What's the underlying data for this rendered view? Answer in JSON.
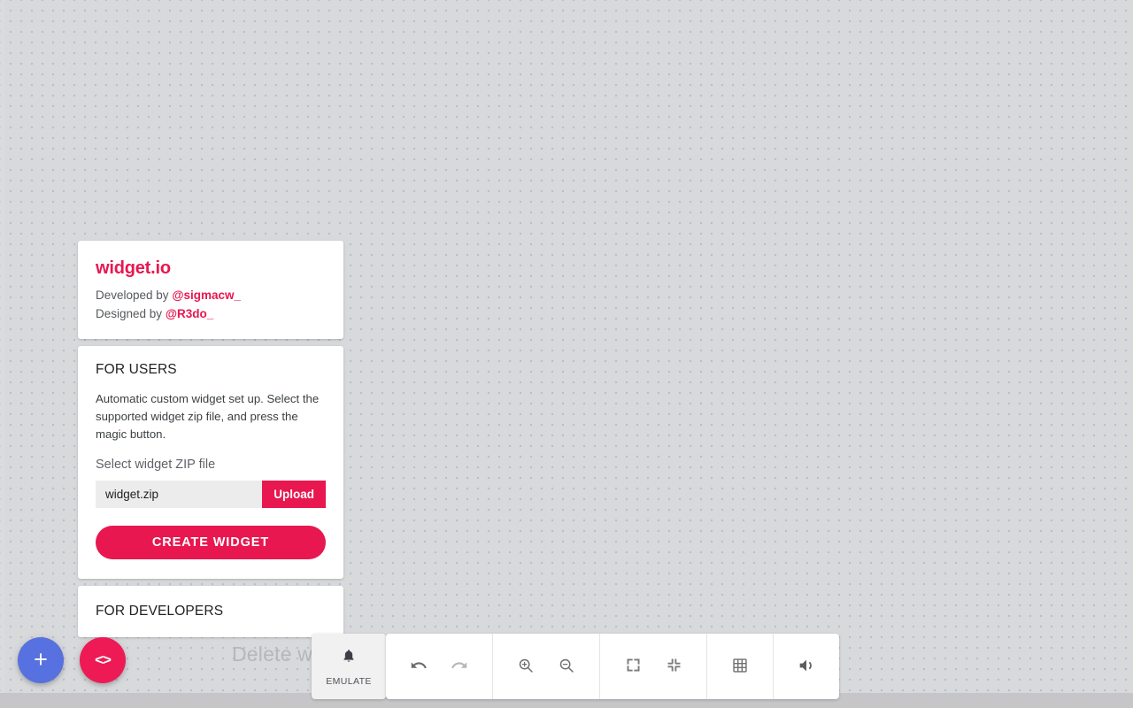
{
  "canvas": {
    "ghost_label": "Delete w",
    "background_color": "#d8d9db",
    "dot_color": "#b9bcd4"
  },
  "theme": {
    "accent": "#e8174f",
    "fab_add_color": "#5771e0",
    "fab_code_color": "#ed1a55"
  },
  "logo_card": {
    "brand": "widget.io",
    "developed_prefix": "Developed by ",
    "developed_handle": "@sigmacw_",
    "designed_prefix": "Designed by ",
    "designed_handle": "@R3do_"
  },
  "users_card": {
    "heading": "FOR USERS",
    "description": "Automatic custom widget set up. Select the supported widget zip file, and press the magic button.",
    "file_label": "Select widget ZIP file",
    "file_name": "widget.zip",
    "upload_label": "Upload",
    "create_label": "CREATE WIDGET"
  },
  "developers_card": {
    "heading": "FOR DEVELOPERS"
  },
  "fabs": [
    {
      "name": "add",
      "glyph": "+"
    },
    {
      "name": "code",
      "glyph": "<>"
    }
  ],
  "toolbar": {
    "emulate_label": "EMULATE",
    "emulate_icon": "bell-icon",
    "groups": [
      {
        "buttons": [
          {
            "name": "undo-button",
            "icon": "undo-icon",
            "state": "enabled"
          },
          {
            "name": "redo-button",
            "icon": "redo-icon",
            "state": "disabled"
          }
        ]
      },
      {
        "buttons": [
          {
            "name": "zoom-in-button",
            "icon": "zoom-in-icon",
            "state": "enabled"
          },
          {
            "name": "zoom-out-button",
            "icon": "zoom-out-icon",
            "state": "enabled"
          }
        ]
      },
      {
        "buttons": [
          {
            "name": "fullscreen-enter-button",
            "icon": "fullscreen-expand-icon",
            "state": "enabled"
          },
          {
            "name": "fullscreen-exit-button",
            "icon": "fullscreen-collapse-icon",
            "state": "enabled"
          }
        ]
      },
      {
        "buttons": [
          {
            "name": "grid-toggle-button",
            "icon": "grid-icon",
            "state": "enabled"
          }
        ]
      },
      {
        "buttons": [
          {
            "name": "volume-button",
            "icon": "volume-icon",
            "state": "enabled"
          }
        ]
      }
    ]
  }
}
